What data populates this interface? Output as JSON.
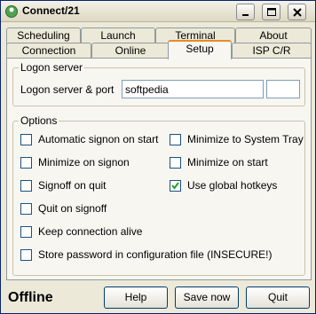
{
  "window": {
    "title": "Connect/21",
    "icon": "app-icon"
  },
  "tabs_back": [
    {
      "label": "Scheduling"
    },
    {
      "label": "Launch"
    },
    {
      "label": "Terminal"
    },
    {
      "label": "About"
    }
  ],
  "tabs_front": [
    {
      "label": "Connection"
    },
    {
      "label": "Online"
    },
    {
      "label": "Setup",
      "active": true
    },
    {
      "label": "ISP C/R"
    }
  ],
  "logon": {
    "group_title": "Logon server",
    "field_label": "Logon server & port",
    "server_value": "softpedia",
    "port_value": ""
  },
  "options": {
    "group_title": "Options",
    "left": [
      {
        "label": "Automatic signon on start",
        "checked": false
      },
      {
        "label": "Minimize on signon",
        "checked": false
      },
      {
        "label": "Signoff on quit",
        "checked": false
      },
      {
        "label": "Quit on signoff",
        "checked": false
      },
      {
        "label": "Keep connection alive",
        "checked": false
      },
      {
        "label": "Store password in configuration file (INSECURE!)",
        "checked": false
      }
    ],
    "right": [
      {
        "label": "Minimize to System Tray",
        "checked": false
      },
      {
        "label": "Minimize on start",
        "checked": false
      },
      {
        "label": "Use global hotkeys",
        "checked": true
      }
    ]
  },
  "footer": {
    "status": "Offline",
    "help_label": "Help",
    "save_label": "Save now",
    "quit_label": "Quit"
  },
  "colors": {
    "accent_tab": "#E68B2C",
    "check": "#21A121"
  }
}
